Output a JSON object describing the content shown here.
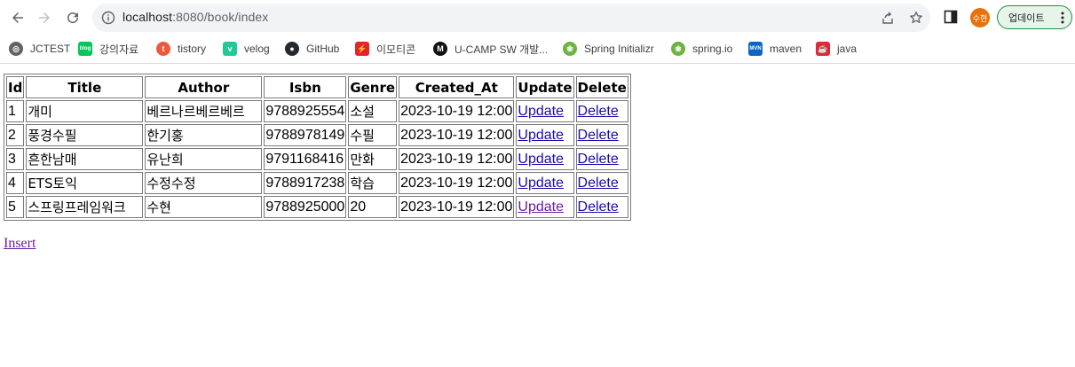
{
  "browser": {
    "url_host": "localhost",
    "url_rest": ":8080/book/index",
    "avatar_label": "수현",
    "update_label": "업데이트"
  },
  "bookmarks": [
    {
      "label": "JCTEST",
      "icon": "globe-icon",
      "color": "#5f6368"
    },
    {
      "label": "강의자료",
      "icon": "blog-icon",
      "color": "#03c75a"
    },
    {
      "label": "tistory",
      "icon": "tistory-icon",
      "color": "#eb5a3c"
    },
    {
      "label": "velog",
      "icon": "velog-icon",
      "color": "#20c997"
    },
    {
      "label": "GitHub",
      "icon": "github-icon",
      "color": "#24292f"
    },
    {
      "label": "이모티콘",
      "icon": "emoticon-icon",
      "color": "#e8212e"
    },
    {
      "label": "U-CAMP SW 개발...",
      "icon": "ucamp-icon",
      "color": "#111111"
    },
    {
      "label": "Spring Initializr",
      "icon": "spring-icon",
      "color": "#6db33f"
    },
    {
      "label": "spring.io",
      "icon": "spring-icon",
      "color": "#6db33f"
    },
    {
      "label": "maven",
      "icon": "maven-icon",
      "color": "#0a66c2"
    },
    {
      "label": "java",
      "icon": "java-icon",
      "color": "#e32636"
    }
  ],
  "table": {
    "headers": [
      "Id",
      "Title",
      "Author",
      "Isbn",
      "Genre",
      "Created_At",
      "Update",
      "Delete"
    ],
    "rows": [
      {
        "id": "1",
        "title": "개미",
        "author": "베르나르베르베르",
        "isbn": "9788925554",
        "genre": "소설",
        "created_at": "2023-10-19 12:00",
        "update": "Update",
        "delete": "Delete"
      },
      {
        "id": "2",
        "title": "풍경수필",
        "author": "한기홍",
        "isbn": "9788978149",
        "genre": "수필",
        "created_at": "2023-10-19 12:00",
        "update": "Update",
        "delete": "Delete"
      },
      {
        "id": "3",
        "title": "흔한남매",
        "author": "유난희",
        "isbn": "9791168416",
        "genre": "만화",
        "created_at": "2023-10-19 12:00",
        "update": "Update",
        "delete": "Delete"
      },
      {
        "id": "4",
        "title": "ETS토익",
        "author": "수정수정",
        "isbn": "9788917238",
        "genre": "학습",
        "created_at": "2023-10-19 12:00",
        "update": "Update",
        "delete": "Delete"
      },
      {
        "id": "5",
        "title": "스프링프레임워크",
        "author": "수현",
        "isbn": "9788925000",
        "genre": "20",
        "created_at": "2023-10-19 12:00",
        "update": "Update",
        "delete": "Delete"
      }
    ]
  },
  "insert_label": "Insert"
}
